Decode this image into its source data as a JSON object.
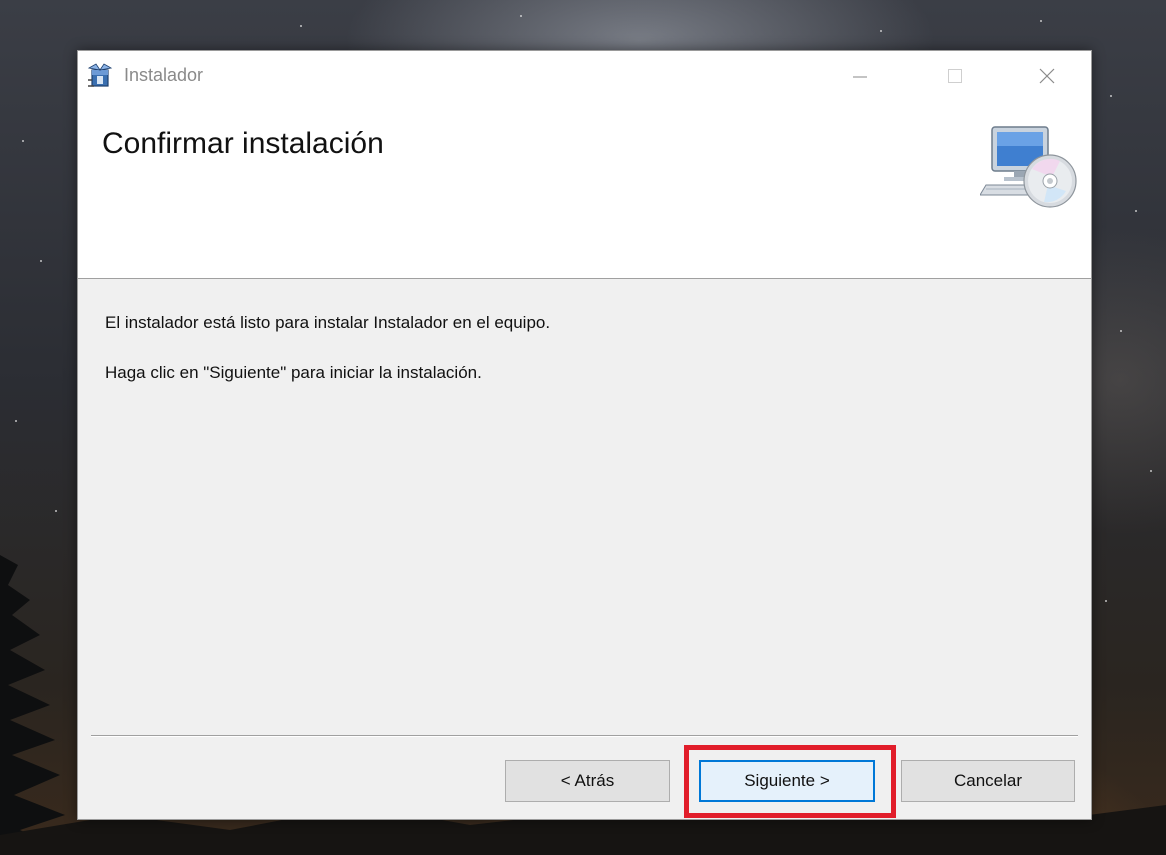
{
  "window": {
    "title": "Instalador",
    "header_title": "Confirmar instalación"
  },
  "content": {
    "line1": "El instalador está listo para instalar Instalador en el equipo.",
    "line2": "Haga clic en \"Siguiente\" para iniciar la instalación."
  },
  "buttons": {
    "back_label": "< Atrás",
    "next_label": "Siguiente >",
    "cancel_label": "Cancelar"
  },
  "icons": {
    "app": "installer-box-icon",
    "header": "computer-disc-icon",
    "minimize": "minimize-icon",
    "maximize": "maximize-icon",
    "close": "close-icon"
  },
  "colors": {
    "highlight": "#e11d2a",
    "focus_border": "#0078d7",
    "window_bg": "#f0f0f0"
  }
}
